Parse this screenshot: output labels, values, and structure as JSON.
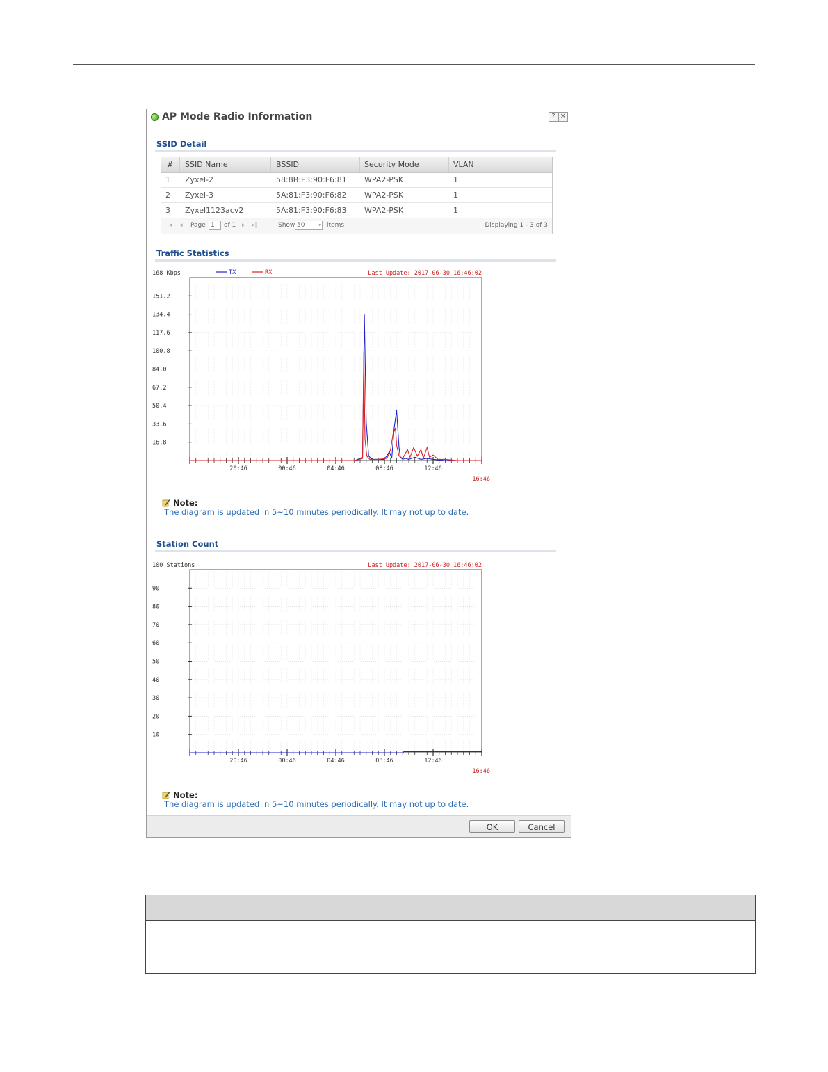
{
  "dialog": {
    "title": "AP Mode Radio Information",
    "help_icon": "help-icon",
    "close_icon": "close-icon"
  },
  "ssid_detail": {
    "title": "SSID Detail",
    "columns": [
      "#",
      "SSID Name",
      "BSSID",
      "Security Mode",
      "VLAN"
    ],
    "rows": [
      [
        "1",
        "Zyxel-2",
        "58:8B:F3:90:F6:81",
        "WPA2-PSK",
        "1"
      ],
      [
        "2",
        "Zyxel-3",
        "5A:81:F3:90:F6:82",
        "WPA2-PSK",
        "1"
      ],
      [
        "3",
        "Zyxel1123acv2",
        "5A:81:F3:90:F6:83",
        "WPA2-PSK",
        "1"
      ]
    ],
    "pager": {
      "page_label": "Page",
      "page_value": "1",
      "of_label": "of 1",
      "show_label": "Show",
      "show_value": "50",
      "items_label": "items",
      "displaying": "Displaying 1 - 3 of 3"
    }
  },
  "traffic": {
    "title": "Traffic Statistics",
    "note_label": "Note:",
    "note_text": "The diagram is updated in 5~10 minutes periodically. It may not up to date."
  },
  "station": {
    "title": "Station Count",
    "note_label": "Note:",
    "note_text": "The diagram is updated in 5~10 minutes periodically. It may not up to date."
  },
  "buttons": {
    "ok": "OK",
    "cancel": "Cancel"
  },
  "colors": {
    "tx": "#2222cc",
    "rx": "#dd2222",
    "section_title": "#1f4f8f",
    "note_text": "#2d6fb5"
  },
  "chart_data": [
    {
      "type": "line",
      "top_label": "168 Kbps",
      "updated": "Last Update: 2017-06-30 16:46:02",
      "ylim": [
        0,
        168
      ],
      "yticks": [
        "151.2",
        "134.4",
        "117.6",
        "100.8",
        "84.0",
        "67.2",
        "50.4",
        "33.6",
        "16.8"
      ],
      "ytick_values": [
        151.2,
        134.4,
        117.6,
        100.8,
        84.0,
        67.2,
        50.4,
        33.6,
        16.8
      ],
      "xticks": [
        "20:46",
        "00:46",
        "04:46",
        "08:46",
        "12:46"
      ],
      "xtick_hours": [
        4,
        8,
        12,
        16,
        20
      ],
      "x_end_label": "16:46",
      "x_end_hour": 24,
      "series": [
        {
          "name": "TX",
          "color": "#2222cc",
          "x": [
            0,
            13.6,
            14.2,
            14.35,
            14.5,
            14.7,
            15.0,
            16.0,
            16.4,
            16.6,
            16.8,
            17.0,
            17.2,
            17.3,
            17.5,
            17.7,
            18.0,
            18.5,
            19.0,
            19.5,
            20.0,
            21.0,
            22.0,
            23.0,
            24.0
          ],
          "y": [
            0,
            0,
            3,
            134,
            35,
            4,
            1,
            1,
            8,
            2,
            30,
            46,
            12,
            3,
            1,
            2,
            1,
            3,
            1,
            2,
            1,
            0,
            0,
            0,
            0
          ]
        },
        {
          "name": "RX",
          "color": "#dd2222",
          "x": [
            0,
            13.6,
            14.2,
            14.3,
            14.4,
            14.55,
            14.8,
            15.5,
            16.2,
            16.5,
            16.7,
            16.9,
            17.0,
            17.2,
            17.5,
            17.9,
            18.1,
            18.4,
            18.7,
            19.0,
            19.2,
            19.5,
            19.7,
            20.0,
            20.4,
            21.0,
            22.0,
            23.0,
            24.0
          ],
          "y": [
            0,
            0,
            2,
            100,
            20,
            4,
            1,
            1,
            2,
            10,
            24,
            30,
            14,
            4,
            2,
            10,
            3,
            12,
            4,
            10,
            2,
            12,
            3,
            5,
            1,
            1,
            0,
            0,
            0
          ]
        }
      ]
    },
    {
      "type": "line",
      "top_label": "100 Stations",
      "updated": "Last Update: 2017-06-30 16:46:02",
      "ylim": [
        0,
        100
      ],
      "yticks": [
        "90",
        "80",
        "70",
        "60",
        "50",
        "40",
        "30",
        "20",
        "10"
      ],
      "ytick_values": [
        90,
        80,
        70,
        60,
        50,
        40,
        30,
        20,
        10
      ],
      "xticks": [
        "20:46",
        "00:46",
        "04:46",
        "08:46",
        "12:46"
      ],
      "xtick_hours": [
        4,
        8,
        12,
        16,
        20
      ],
      "x_end_label": "16:46",
      "x_end_hour": 24,
      "series": [
        {
          "color": "#2222cc",
          "x": [
            0,
            17.5,
            17.6,
            24
          ],
          "y": [
            0,
            0,
            0.6,
            0.6
          ]
        }
      ]
    }
  ],
  "doc_table": {
    "rows": [
      [
        "",
        ""
      ],
      [
        "",
        ""
      ],
      [
        "",
        ""
      ]
    ]
  }
}
